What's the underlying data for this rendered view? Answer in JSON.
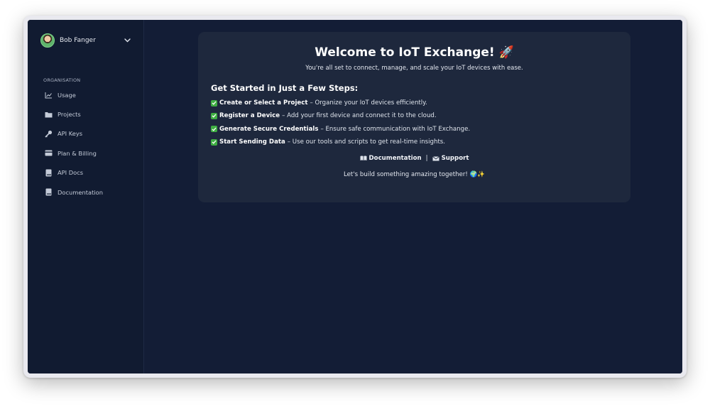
{
  "user": {
    "name": "Bob Fanger"
  },
  "sidebar": {
    "section_label": "ORGANISATION",
    "items": [
      {
        "label": "Usage",
        "icon": "chart-line-icon"
      },
      {
        "label": "Projects",
        "icon": "folder-icon"
      },
      {
        "label": "API Keys",
        "icon": "key-icon"
      },
      {
        "label": "Plan & Billing",
        "icon": "credit-card-icon"
      },
      {
        "label": "API Docs",
        "icon": "book-icon"
      },
      {
        "label": "Documentation",
        "icon": "book-icon"
      }
    ]
  },
  "welcome": {
    "title": "Welcome to IoT Exchange! 🚀",
    "subtitle": "You're all set to connect, manage, and scale your IoT devices with ease.",
    "steps_title": "Get Started in Just a Few Steps:",
    "steps": [
      {
        "bold": "Create or Select a Project",
        "text": "– Organize your IoT devices efficiently."
      },
      {
        "bold": "Register a Device",
        "text": "– Add your first device and connect it to the cloud."
      },
      {
        "bold": "Generate Secure Credentials",
        "text": "– Ensure safe communication with IoT Exchange."
      },
      {
        "bold": "Start Sending Data",
        "text": "– Use our tools and scripts to get real-time insights."
      }
    ],
    "links": {
      "documentation": "Documentation",
      "separator": "|",
      "support": "Support"
    },
    "closing": "Let's build something amazing together! 🌍✨"
  },
  "colors": {
    "background": "#131d36",
    "sidebar": "#111b31",
    "card": "#1e283d",
    "check": "#3fae43"
  }
}
